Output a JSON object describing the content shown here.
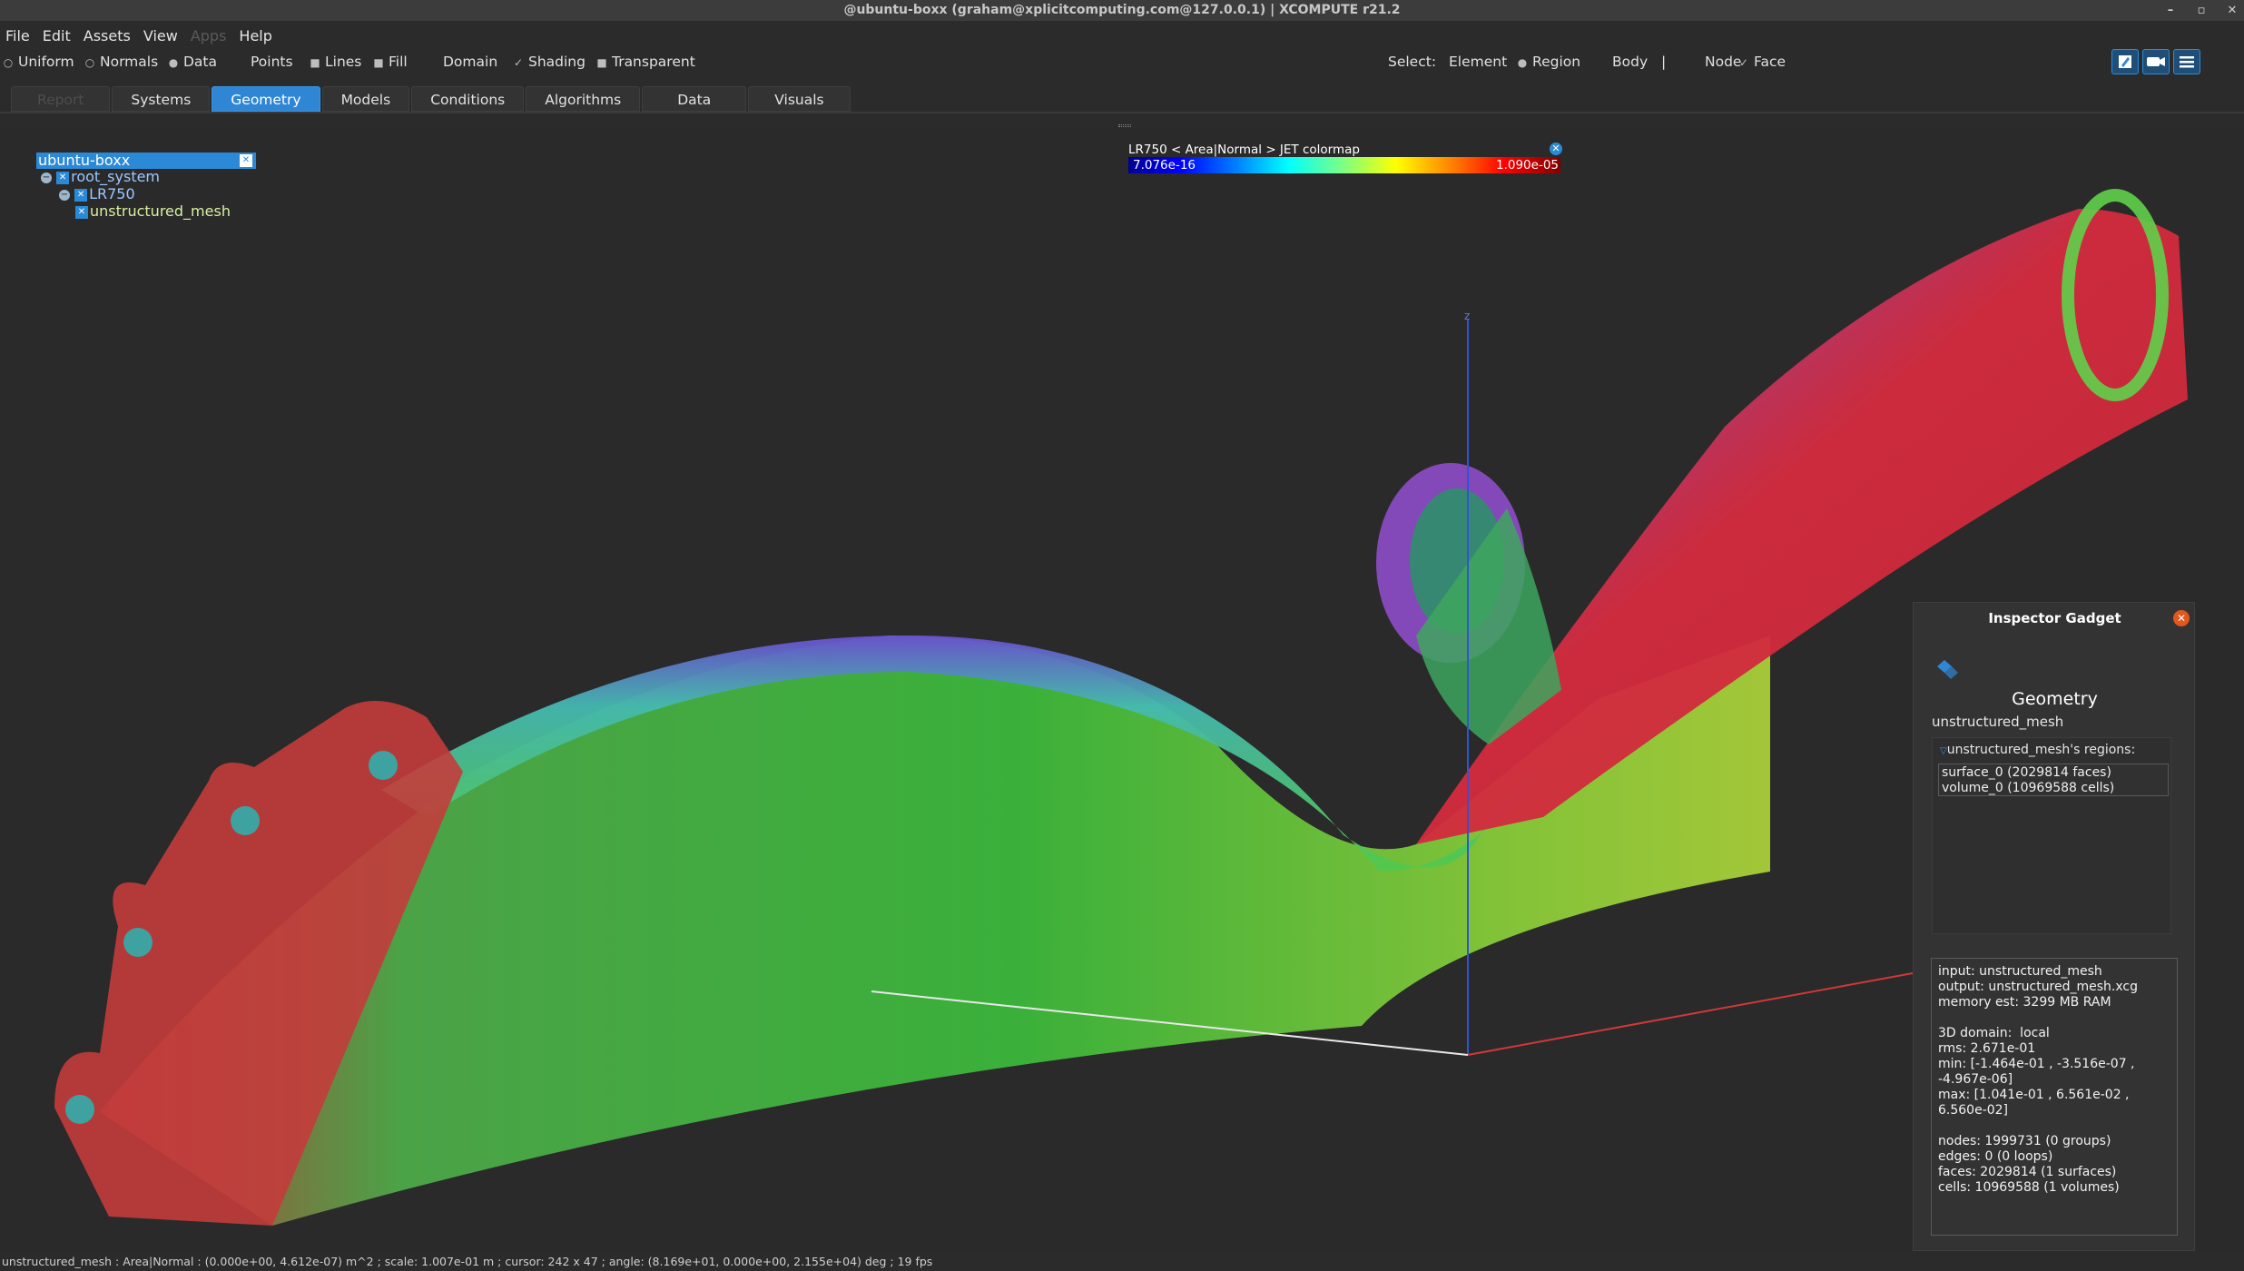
{
  "window": {
    "title": "@ubuntu-boxx (graham@xplicitcomputing.com@127.0.0.1) | XCOMPUTE r21.2"
  },
  "menu": {
    "items": [
      "File",
      "Edit",
      "Assets",
      "View",
      "Apps",
      "Help"
    ]
  },
  "toolbar": {
    "uniform": "Uniform",
    "normals": "Normals",
    "data": "Data",
    "points": "Points",
    "lines": "Lines",
    "fill": "Fill",
    "domain": "Domain",
    "shading": "Shading",
    "transparent": "Transparent",
    "select_label": "Select:",
    "element": "Element",
    "region": "Region",
    "body": "Body",
    "separator": "|",
    "node": "Node",
    "face": "Face",
    "check_mark": "✓"
  },
  "tabs": [
    "Report",
    "Systems",
    "Geometry",
    "Models",
    "Conditions",
    "Algorithms",
    "Data",
    "Visuals"
  ],
  "tree": {
    "root": "ubuntu-boxx",
    "system": "root_system",
    "model": "LR750",
    "mesh": "unstructured_mesh"
  },
  "colormap": {
    "title": "LR750 < Area|Normal > JET colormap",
    "min": "7.076e-16",
    "max": "1.090e-05"
  },
  "axis": {
    "z_label": "z"
  },
  "inspector": {
    "title": "Inspector Gadget",
    "heading": "Geometry",
    "name": "unstructured_mesh",
    "regions_label": "unstructured_mesh's regions:",
    "regions": [
      "surface_0 (2029814 faces)",
      "volume_0 (10969588 cells)"
    ],
    "info": "input: unstructured_mesh\noutput: unstructured_mesh.xcg\nmemory est: 3299 MB RAM\n\n3D domain:  local\nrms: 2.671e-01\nmin: [-1.464e-01 , -3.516e-07 ,\n-4.967e-06]\nmax: [1.041e-01 , 6.561e-02 ,\n6.560e-02]\n\nnodes: 1999731 (0 groups)\nedges: 0 (0 loops)\nfaces: 2029814 (1 surfaces)\ncells: 10969588 (1 volumes)"
  },
  "status": "unstructured_mesh : Area|Normal : (0.000e+00, 4.612e-07) m^2 ; scale: 1.007e-01 m ; cursor: 242 x 47 ; angle: (8.169e+01, 0.000e+00, 2.155e+04) deg ; 19 fps",
  "colors": {
    "accent": "#2f86d4",
    "close": "#e2571b",
    "background": "#2a2a2a"
  }
}
